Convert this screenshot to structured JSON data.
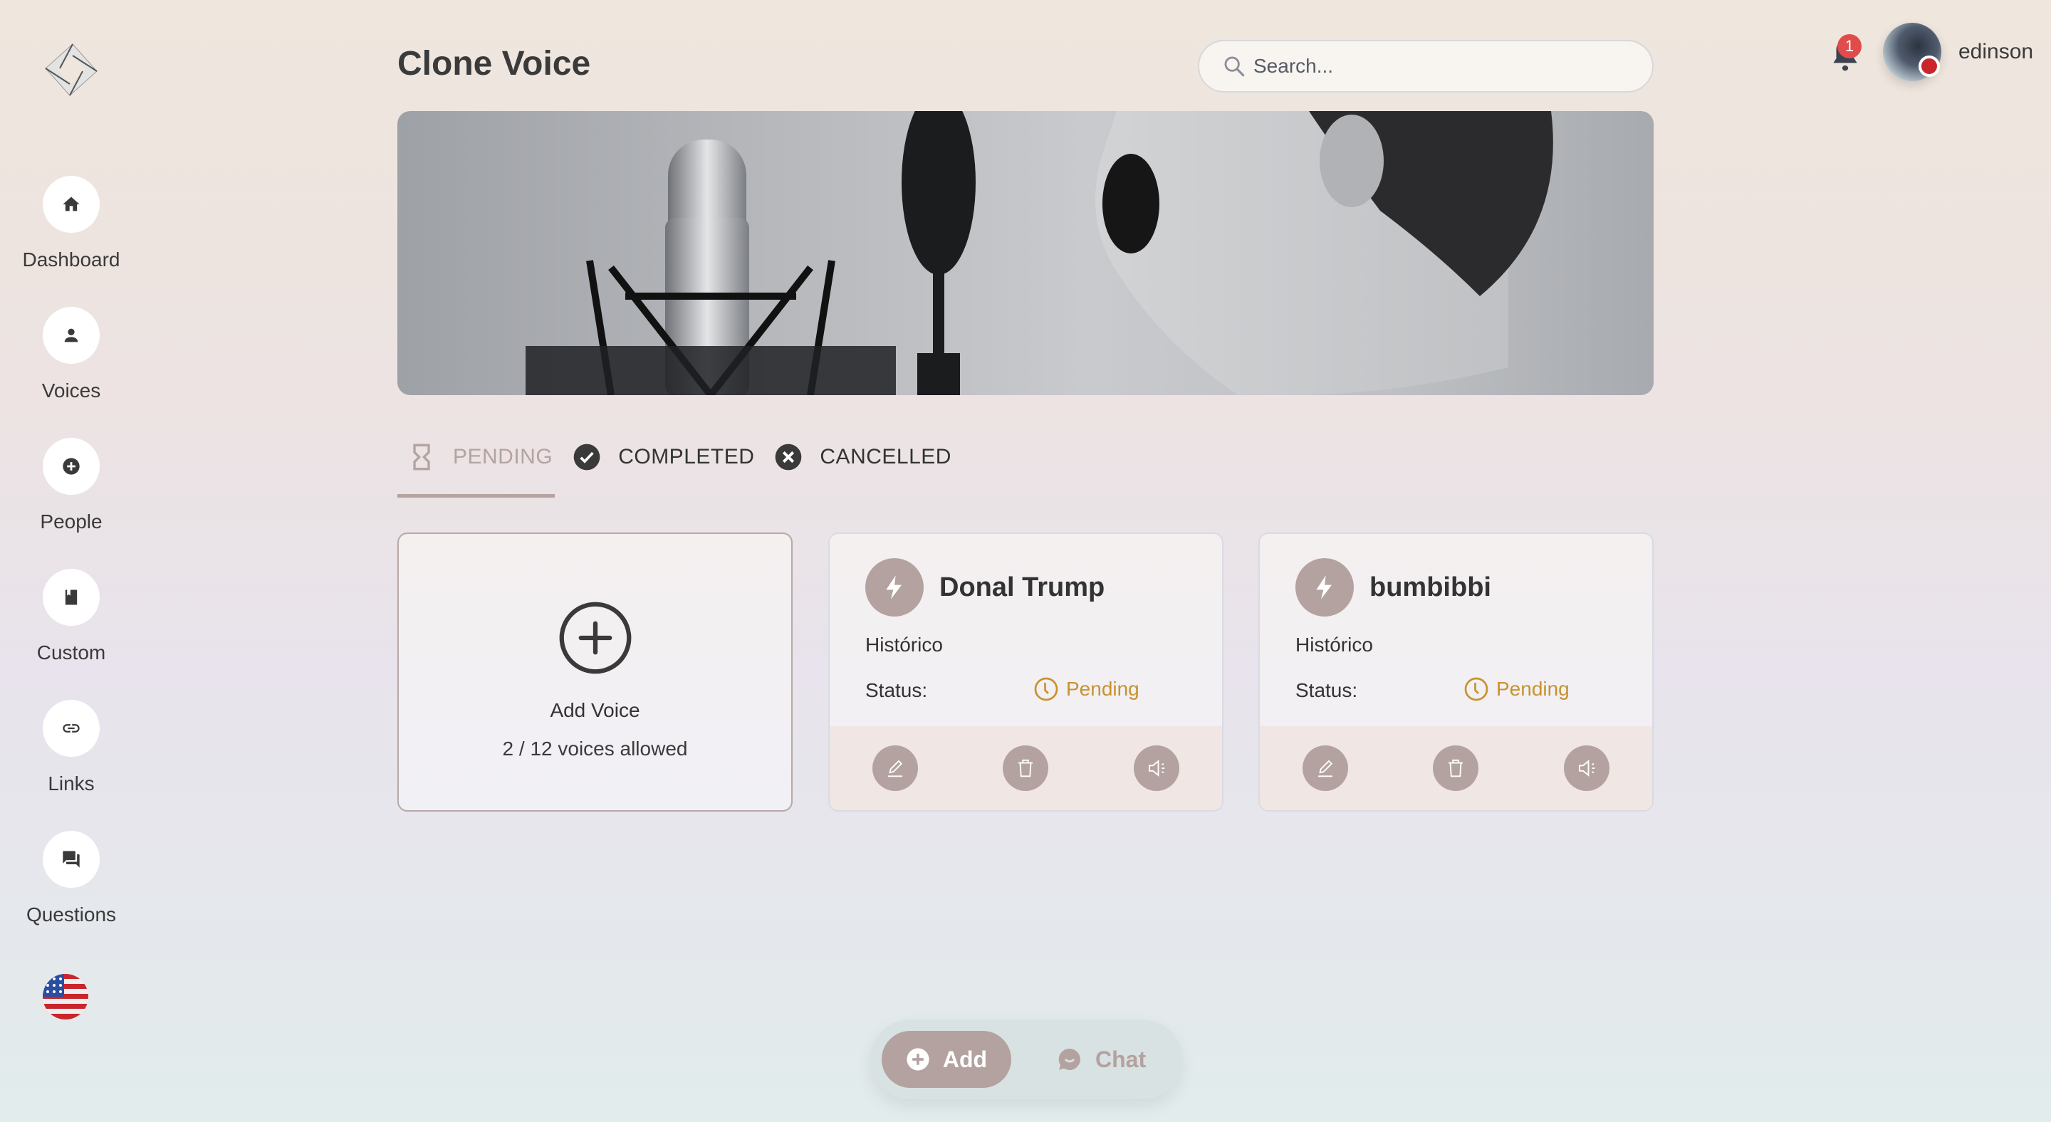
{
  "app": {
    "logo": "app-logo"
  },
  "sidebar": {
    "items": [
      {
        "label": "Dashboard",
        "icon": "home-icon"
      },
      {
        "label": "Voices",
        "icon": "person-icon"
      },
      {
        "label": "People",
        "icon": "add-circle-icon"
      },
      {
        "label": "Custom",
        "icon": "book-icon"
      },
      {
        "label": "Links",
        "icon": "link-icon"
      },
      {
        "label": "Questions",
        "icon": "forum-icon"
      }
    ],
    "language": {
      "icon": "us-flag-icon",
      "value": "en-US"
    }
  },
  "header": {
    "title": "Clone Voice",
    "search": {
      "placeholder": "Search...",
      "value": ""
    },
    "notifications": {
      "count": "1"
    },
    "user": {
      "name": "edinson"
    }
  },
  "tabs": [
    {
      "label": "PENDING",
      "icon": "hourglass-icon",
      "active": true
    },
    {
      "label": "COMPLETED",
      "icon": "check-circle-icon",
      "active": false
    },
    {
      "label": "CANCELLED",
      "icon": "cancel-circle-icon",
      "active": false
    }
  ],
  "add_card": {
    "title": "Add Voice",
    "subtitle": "2 / 12 voices allowed",
    "used": 2,
    "allowed": 12
  },
  "voices": [
    {
      "name": "Donal Trump",
      "category": "Histórico",
      "status_label": "Status:",
      "status": "Pending"
    },
    {
      "name": "bumbibbi",
      "category": "Histórico",
      "status_label": "Status:",
      "status": "Pending"
    }
  ],
  "bottom_bar": {
    "add_label": "Add",
    "chat_label": "Chat"
  },
  "colors": {
    "accent": "#b4a2a0",
    "pending": "#c8922e",
    "text": "#3a3a3a",
    "badge": "#e04b4b"
  }
}
